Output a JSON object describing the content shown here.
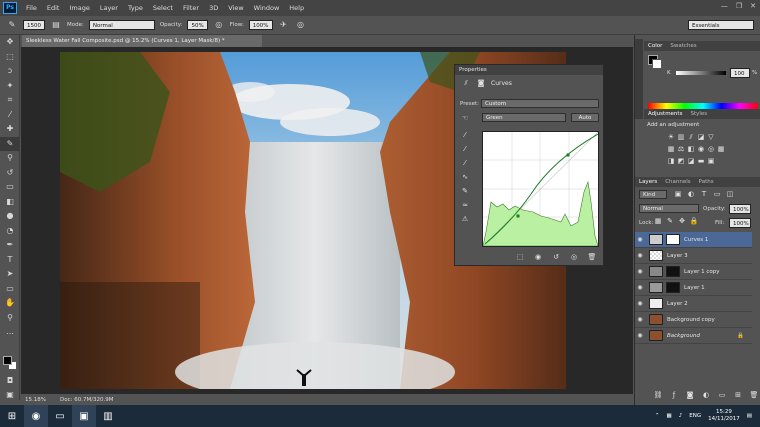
{
  "app": {
    "logo": "Ps",
    "menu": [
      "File",
      "Edit",
      "Image",
      "Layer",
      "Type",
      "Select",
      "Filter",
      "3D",
      "View",
      "Window",
      "Help"
    ],
    "win_controls": [
      "—",
      "❐",
      "✕"
    ]
  },
  "options": {
    "brush_size": "1500",
    "mode_label": "Mode:",
    "mode_value": "Normal",
    "opacity_label": "Opacity:",
    "opacity_value": "50%",
    "flow_label": "Flow:",
    "flow_value": "100%",
    "workspace": "Essentials"
  },
  "document": {
    "tab_title": "Sleekless Water Fall Composite.psd @ 15.2% (Curves 1, Layer Mask/8) *",
    "zoom": "15.18%",
    "doc_size": "Doc: 60.7M/320.9M"
  },
  "properties": {
    "header": "Properties",
    "title": "Curves",
    "preset_label": "Preset:",
    "preset_value": "Custom",
    "channel_value": "Green",
    "auto_label": "Auto"
  },
  "color_panel": {
    "tabs": [
      "Color",
      "Swatches"
    ],
    "slider_label": "K",
    "slider_value": "100",
    "slider_unit": "%"
  },
  "adjustments": {
    "tabs": [
      "Adjustments",
      "Styles"
    ],
    "heading": "Add an adjustment"
  },
  "layers": {
    "tabs": [
      "Layers",
      "Channels",
      "Paths"
    ],
    "kind": "Kind",
    "blend_mode": "Normal",
    "opacity_label": "Opacity:",
    "opacity_value": "100%",
    "lock_label": "Lock:",
    "fill_label": "Fill:",
    "fill_value": "100%",
    "items": [
      {
        "name": "Curves 1",
        "selected": true
      },
      {
        "name": "Layer 3",
        "selected": false
      },
      {
        "name": "Layer 1 copy",
        "selected": false
      },
      {
        "name": "Layer 1",
        "selected": false
      },
      {
        "name": "Layer 2",
        "selected": false
      },
      {
        "name": "Background copy",
        "selected": false
      },
      {
        "name": "Background",
        "selected": false
      }
    ]
  },
  "taskbar": {
    "time": "15:29",
    "date": "14/11/2017",
    "lang": "ENG"
  }
}
